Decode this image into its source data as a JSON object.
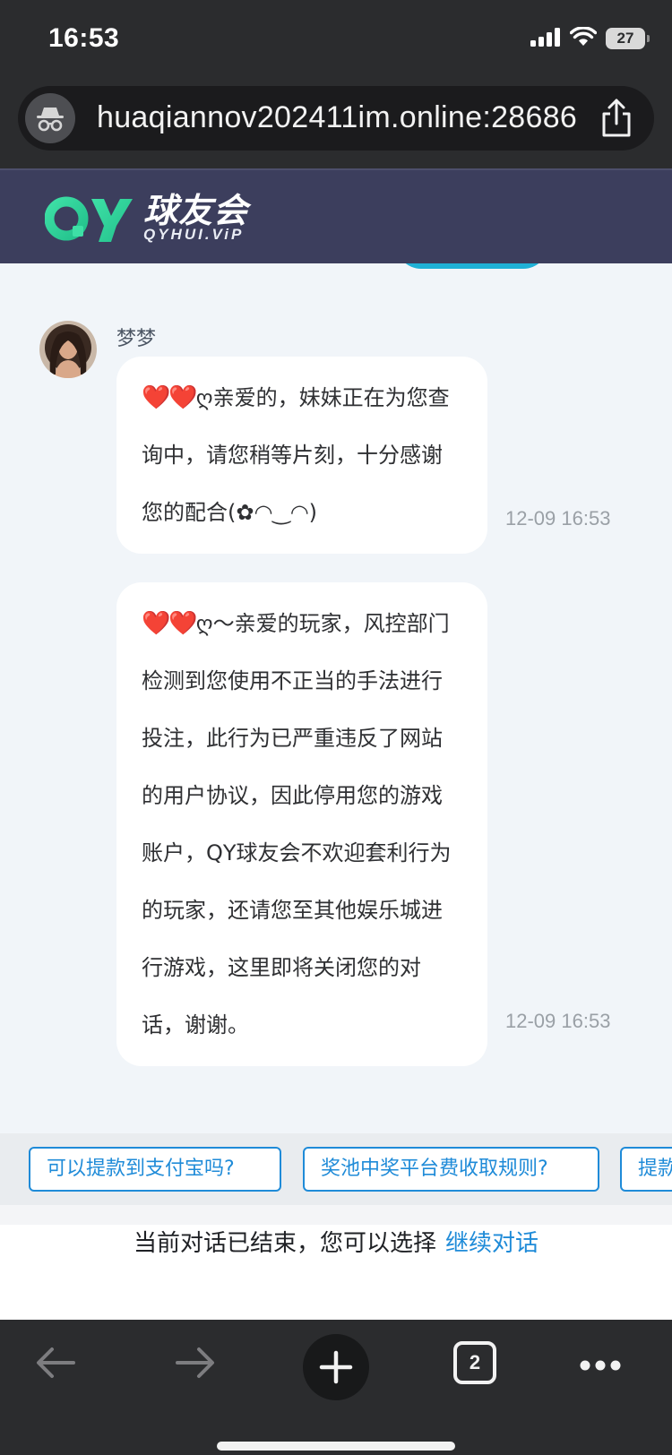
{
  "status_bar": {
    "time": "16:53",
    "battery": "27"
  },
  "browser": {
    "url": "huaqiannov202411im.online:28686",
    "tab_count": "2"
  },
  "site": {
    "logo_mark": "QY",
    "logo_title": "球友会",
    "logo_subtitle": "QYHUI.ViP"
  },
  "chat": {
    "agent_name": "梦梦",
    "messages": [
      {
        "hearts": "❤️❤️",
        "text": "ღ亲爱的，妹妹正在为您查询中，请您稍等片刻，十分感谢您的配合(✿◠‿◠)",
        "time": "12-09 16:53"
      },
      {
        "hearts": "❤️❤️",
        "text": "ღ～亲爱的玩家，风控部门检测到您使用不正当的手法进行投注，此行为已严重违反了网站的用户协议，因此停用您的游戏账户，QY球友会不欢迎套利行为的玩家，还请您至其他娱乐城进行游戏，这里即将关闭您的对话，谢谢。",
        "time": "12-09 16:53"
      }
    ]
  },
  "quick_questions": [
    "可以提款到支付宝吗?",
    "奖池中奖平台费收取规则?",
    "提款"
  ],
  "conversation": {
    "ended_text": "当前对话已结束，您可以选择",
    "continue_label": "继续对话"
  },
  "colors": {
    "accent": "#1f8bd8",
    "header_bg": "#3c3e5d",
    "logo_green": "#2ed39a",
    "hearts": "#e0161d"
  },
  "icons": [
    "signal-icon",
    "wifi-icon",
    "battery-icon",
    "incognito-icon",
    "share-icon",
    "back-arrow-icon",
    "forward-arrow-icon",
    "plus-icon",
    "more-icon"
  ]
}
